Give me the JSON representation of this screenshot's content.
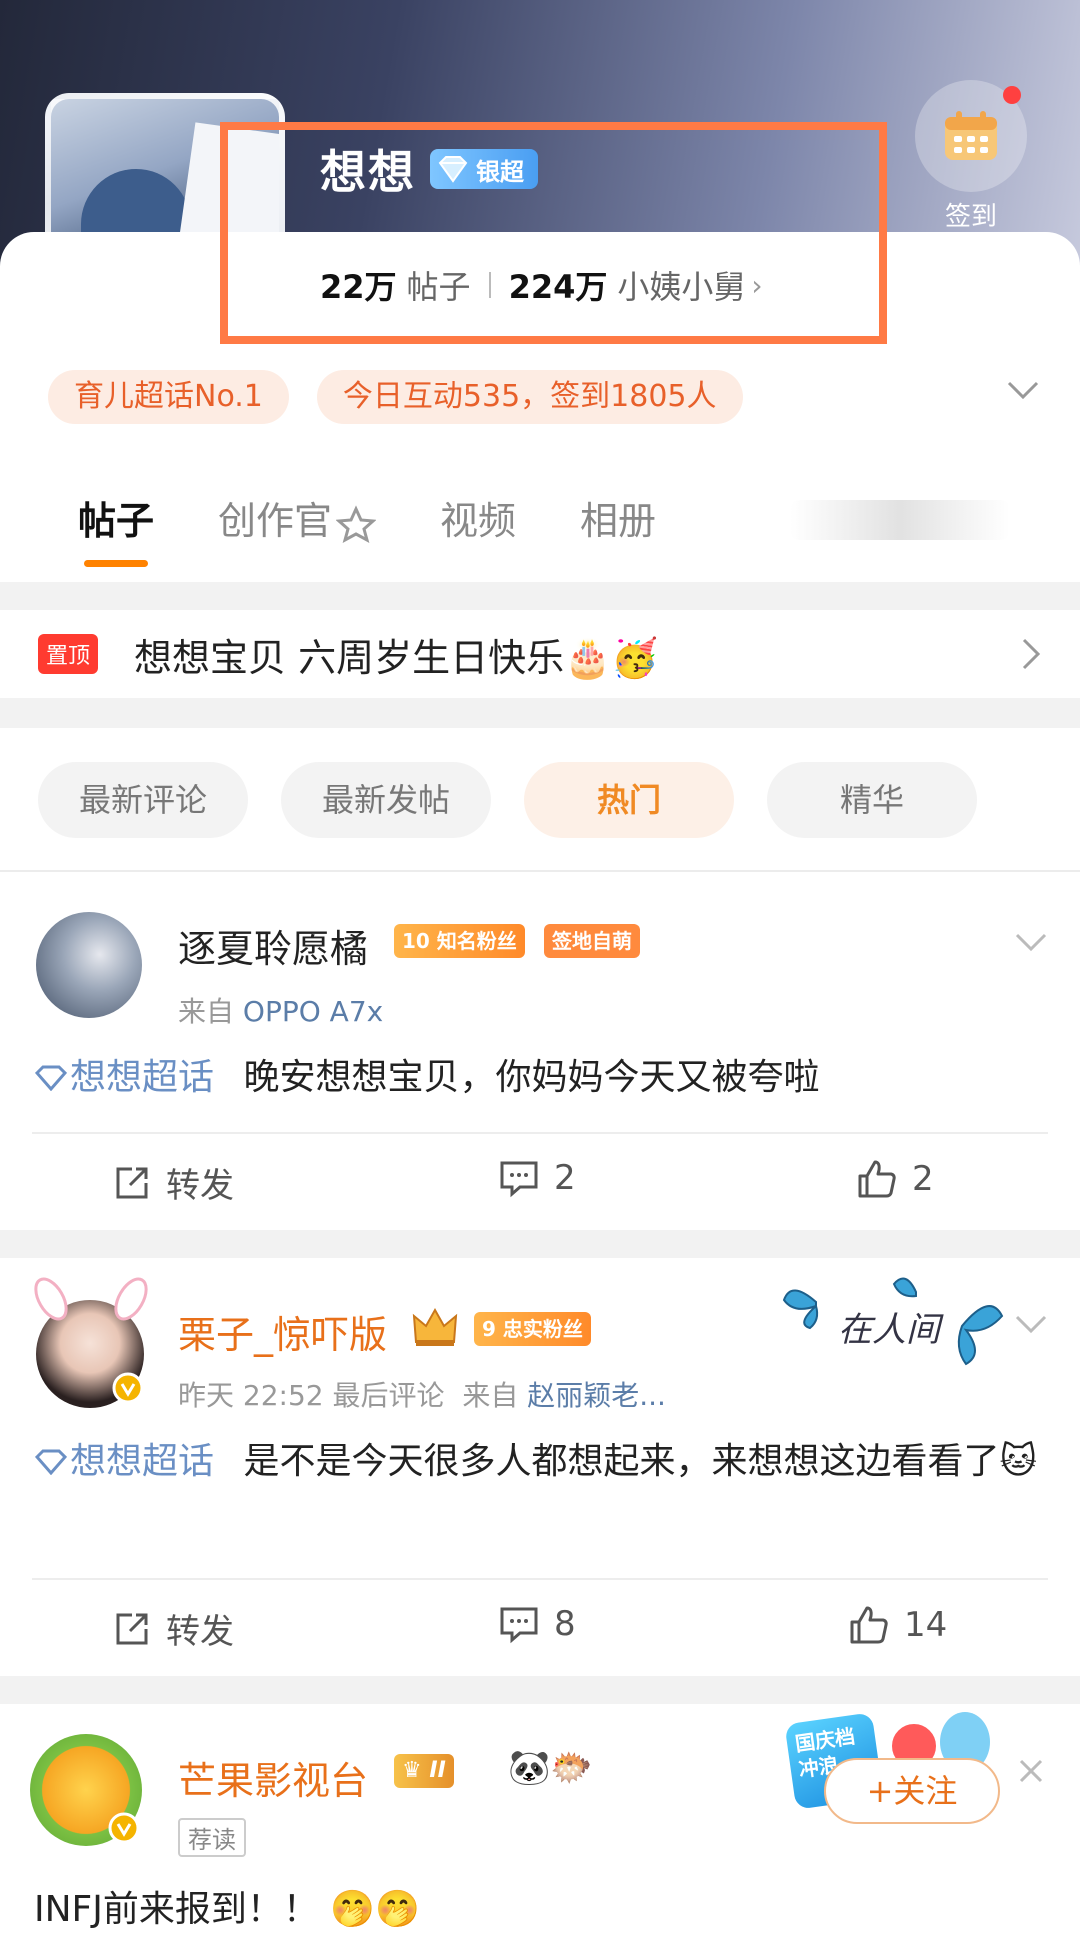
{
  "header": {
    "community_name": "想想",
    "rank_badge": "银超",
    "posts_count": "22万",
    "posts_label": "帖子",
    "members_count": "224万",
    "members_label": "小姨小舅",
    "checkin_label": "签到"
  },
  "tags": [
    "育儿超话No.1",
    "今日互动535，签到1805人"
  ],
  "tabs": [
    "帖子",
    "创作官",
    "视频",
    "相册"
  ],
  "pinned": {
    "badge": "置顶",
    "text": "想想宝贝 六周岁生日快乐🎂🥳"
  },
  "sort_chips": [
    "最新评论",
    "最新发帖",
    "热门",
    "精华"
  ],
  "posts": [
    {
      "username": "逐夏聆愿橘",
      "level": "10",
      "badge1": "知名粉丝",
      "badge2": "签地自萌",
      "meta_prefix": "来自",
      "meta_source": "OPPO A7x",
      "topic": "想想超话",
      "text": "晚安想想宝贝，你妈妈今天又被夸啦",
      "repost_label": "转发",
      "comments": "2",
      "likes": "2"
    },
    {
      "username": "栗子_惊吓版",
      "level": "9",
      "badge1": "忠实粉丝",
      "meta_time": "昨天 22:52 最后评论",
      "meta_prefix": "来自",
      "meta_source": "赵丽颖老...",
      "topic": "想想超话",
      "text": "是不是今天很多人都想起来，来想想这边看看了🐱",
      "deco_text": "在人间",
      "repost_label": "转发",
      "comments": "8",
      "likes": "14"
    },
    {
      "username": "芒果影视台",
      "level": "II",
      "emojis": "🐼🐡",
      "tag": "荐读",
      "follow_label": "+关注",
      "promo_text": "国庆档冲浪",
      "text": "INFJ前来报到！！ 🤭🤭"
    }
  ],
  "colors": {
    "accent": "#ff8200",
    "highlight_box": "#ff7a45",
    "topic": "#6a8fc4",
    "vip_name": "#e8701a"
  }
}
